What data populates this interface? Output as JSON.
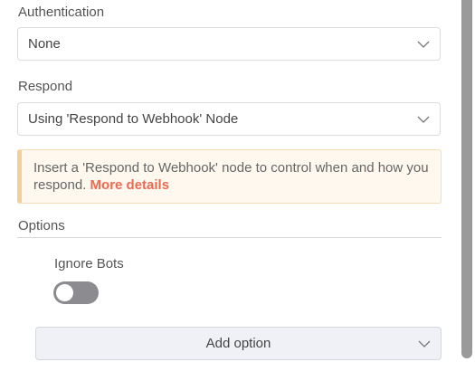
{
  "authentication": {
    "label": "Authentication",
    "selected": "None"
  },
  "respond": {
    "label": "Respond",
    "selected": "Using 'Respond to Webhook' Node"
  },
  "notice": {
    "text": "Insert a 'Respond to Webhook' node to control when and how you respond.",
    "link": "More details"
  },
  "options": {
    "heading": "Options",
    "ignore_bots": {
      "label": "Ignore Bots",
      "enabled": false
    },
    "add_option_label": "Add option"
  },
  "colors": {
    "notice_link": "#ea6a52",
    "notice_bg": "#fef8ef",
    "toggle_off": "#8c8c90"
  }
}
